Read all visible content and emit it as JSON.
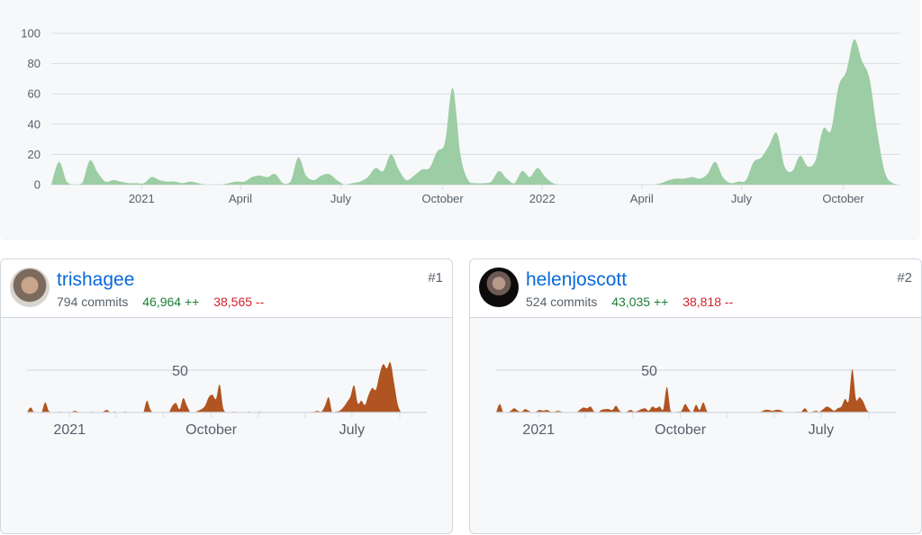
{
  "colors": {
    "main_area": "#9ccda4",
    "contributor_area": "#b05421",
    "grid": "#d8dee4",
    "axis_text": "#57606a",
    "link": "#0969da",
    "additions": "#1a7f37",
    "deletions": "#cf222e"
  },
  "chart_data": [
    {
      "id": "commits-over-time",
      "type": "area",
      "title": "",
      "xlabel": "",
      "ylabel": "",
      "x_unit": "week index (week 0 ≈ early Oct 2020)",
      "x_range": [
        0,
        110
      ],
      "ylim": [
        0,
        100
      ],
      "y_ticks": [
        0,
        20,
        40,
        60,
        80,
        100
      ],
      "grid": true,
      "x_ticks": [
        {
          "label": "2021",
          "week": 11.7
        },
        {
          "label": "April",
          "week": 24.5
        },
        {
          "label": "July",
          "week": 37.5
        },
        {
          "label": "October",
          "week": 50.7
        },
        {
          "label": "2022",
          "week": 63.6
        },
        {
          "label": "April",
          "week": 76.5
        },
        {
          "label": "July",
          "week": 89.4
        },
        {
          "label": "October",
          "week": 102.6
        }
      ],
      "values": [
        0,
        15,
        2,
        0,
        1,
        16,
        8,
        2,
        3,
        2,
        1,
        1,
        1,
        5,
        3,
        2,
        2,
        1,
        2,
        1,
        0,
        0,
        0,
        1,
        2,
        2,
        5,
        6,
        5,
        7,
        1,
        2,
        18,
        6,
        3,
        6,
        7,
        3,
        0,
        1,
        2,
        5,
        11,
        9,
        20,
        10,
        3,
        6,
        10,
        11,
        22,
        28,
        64,
        20,
        3,
        1,
        1,
        2,
        9,
        4,
        1,
        9,
        5,
        11,
        5,
        1,
        0,
        0,
        0,
        0,
        0,
        0,
        0,
        0,
        0,
        0,
        0,
        0,
        0,
        1,
        3,
        4,
        4,
        5,
        4,
        7,
        15,
        5,
        1,
        2,
        3,
        15,
        18,
        26,
        34,
        12,
        9,
        19,
        12,
        16,
        37,
        36,
        65,
        75,
        96,
        82,
        70,
        35,
        8,
        1,
        0
      ]
    },
    {
      "id": "contributor-1",
      "type": "area",
      "x_range": [
        0,
        110
      ],
      "y_ref_line": 50,
      "ylim": [
        0,
        55
      ],
      "x_ticks": [
        {
          "label": "2021",
          "week": 11.7
        },
        {
          "label": "",
          "week": 24.5
        },
        {
          "label": "",
          "week": 37.5
        },
        {
          "label": "October",
          "week": 50.7
        },
        {
          "label": "",
          "week": 63.6
        },
        {
          "label": "",
          "week": 76.5
        },
        {
          "label": "July",
          "week": 89.4
        },
        {
          "label": "",
          "week": 102.6
        }
      ],
      "values": [
        0,
        6,
        0,
        0,
        0,
        12,
        2,
        0,
        0,
        1,
        0,
        0,
        0,
        2,
        1,
        0,
        0,
        0,
        1,
        0,
        0,
        1,
        3,
        0,
        1,
        0,
        0,
        1,
        0,
        0,
        0,
        0,
        0,
        14,
        3,
        0,
        0,
        0,
        0,
        0,
        8,
        11,
        4,
        17,
        8,
        0,
        0,
        2,
        4,
        8,
        18,
        21,
        16,
        33,
        5,
        0,
        0,
        1,
        0,
        0,
        0,
        1,
        0,
        0,
        1,
        0,
        0,
        0,
        0,
        0,
        0,
        0,
        0,
        0,
        0,
        0,
        0,
        0,
        0,
        1,
        2,
        1,
        8,
        18,
        0,
        1,
        2,
        6,
        12,
        19,
        32,
        11,
        14,
        9,
        21,
        29,
        27,
        45,
        57,
        52,
        59,
        35,
        10,
        0,
        0,
        0,
        0,
        0,
        0,
        0,
        0
      ]
    },
    {
      "id": "contributor-2",
      "type": "area",
      "x_range": [
        0,
        110
      ],
      "y_ref_line": 50,
      "ylim": [
        0,
        55
      ],
      "x_ticks": [
        {
          "label": "2021",
          "week": 11.7
        },
        {
          "label": "",
          "week": 24.5
        },
        {
          "label": "",
          "week": 37.5
        },
        {
          "label": "October",
          "week": 50.7
        },
        {
          "label": "",
          "week": 63.6
        },
        {
          "label": "",
          "week": 76.5
        },
        {
          "label": "July",
          "week": 89.4
        },
        {
          "label": "",
          "week": 102.6
        }
      ],
      "values": [
        0,
        10,
        0,
        0,
        2,
        5,
        2,
        1,
        4,
        2,
        0,
        1,
        3,
        2,
        3,
        1,
        1,
        2,
        1,
        0,
        0,
        0,
        0,
        3,
        6,
        5,
        7,
        1,
        0,
        3,
        4,
        4,
        3,
        8,
        2,
        0,
        1,
        3,
        1,
        2,
        4,
        5,
        2,
        7,
        5,
        7,
        4,
        30,
        2,
        0,
        1,
        2,
        10,
        4,
        0,
        9,
        3,
        12,
        2,
        0,
        0,
        0,
        0,
        0,
        0,
        0,
        0,
        0,
        0,
        0,
        0,
        0,
        0,
        1,
        3,
        3,
        2,
        3,
        3,
        1,
        0,
        0,
        0,
        1,
        1,
        5,
        0,
        1,
        2,
        1,
        4,
        7,
        5,
        2,
        5,
        7,
        16,
        14,
        51,
        16,
        18,
        13,
        3,
        0,
        0,
        0,
        0,
        0,
        0,
        0,
        0
      ]
    }
  ],
  "contributors": [
    {
      "username": "trishagee",
      "commits": "794 commits",
      "additions": "46,964 ++",
      "deletions": "38,565 --",
      "rank": "#1",
      "ref_line_label": "50"
    },
    {
      "username": "helenjoscott",
      "commits": "524 commits",
      "additions": "43,035 ++",
      "deletions": "38,818 --",
      "rank": "#2",
      "ref_line_label": "50"
    }
  ]
}
